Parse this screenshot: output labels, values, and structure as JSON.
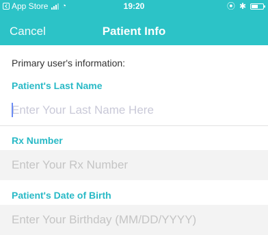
{
  "status_bar": {
    "back_label": "App Store",
    "time": "19:20"
  },
  "nav": {
    "cancel": "Cancel",
    "title": "Patient Info"
  },
  "form": {
    "section_title": "Primary user's information:",
    "fields": [
      {
        "label": "Patient's Last Name",
        "placeholder": "Enter Your Last Name Here",
        "value": ""
      },
      {
        "label": "Rx Number",
        "placeholder": "Enter Your Rx Number",
        "value": ""
      },
      {
        "label": "Patient's Date of Birth",
        "placeholder": "Enter Your Birthday (MM/DD/YYYY)",
        "value": ""
      }
    ]
  },
  "colors": {
    "header": "#2cc3c7",
    "label": "#28b9c6",
    "field_disabled_bg": "#f3f3f3"
  },
  "icons": [
    "back-to-app-icon",
    "signal-icon",
    "wifi-icon",
    "orientation-lock-icon",
    "bluetooth-icon",
    "battery-icon"
  ]
}
